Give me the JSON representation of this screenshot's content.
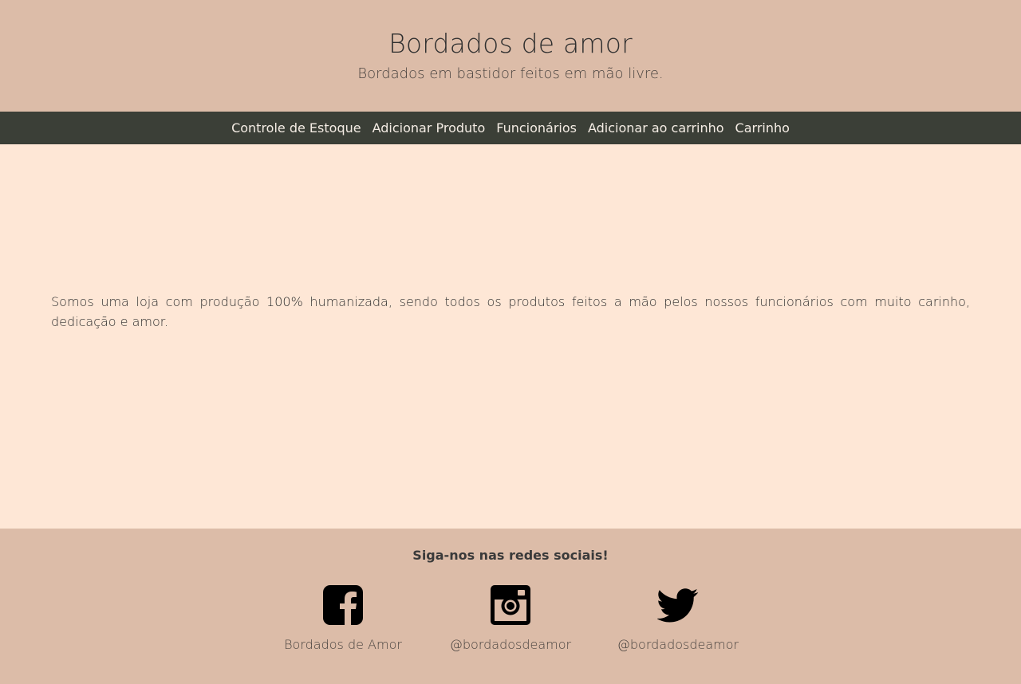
{
  "header": {
    "title": "Bordados de amor",
    "subtitle": "Bordados em bastidor feitos em mão livre."
  },
  "nav": {
    "items": [
      {
        "label": "Controle de Estoque"
      },
      {
        "label": "Adicionar Produto"
      },
      {
        "label": "Funcionários"
      },
      {
        "label": "Adicionar ao carrinho"
      },
      {
        "label": "Carrinho"
      }
    ]
  },
  "main": {
    "about": "Somos uma loja com produção 100% humanizada, sendo todos os produtos feitos a mão pelos nossos funcionários com muito carinho, dedicação e amor."
  },
  "footer": {
    "heading": "Siga-nos nas redes sociais!",
    "socials": [
      {
        "icon": "facebook-icon",
        "label": "Bordados de Amor"
      },
      {
        "icon": "instagram-icon",
        "label": "@bordadosdeamor"
      },
      {
        "icon": "twitter-icon",
        "label": "@bordadosdeamor"
      }
    ]
  },
  "colors": {
    "header_bg": "#dcbca8",
    "nav_bg": "#3b3f37",
    "content_bg": "#fee7d6",
    "footer_bg": "#dcbca8"
  }
}
